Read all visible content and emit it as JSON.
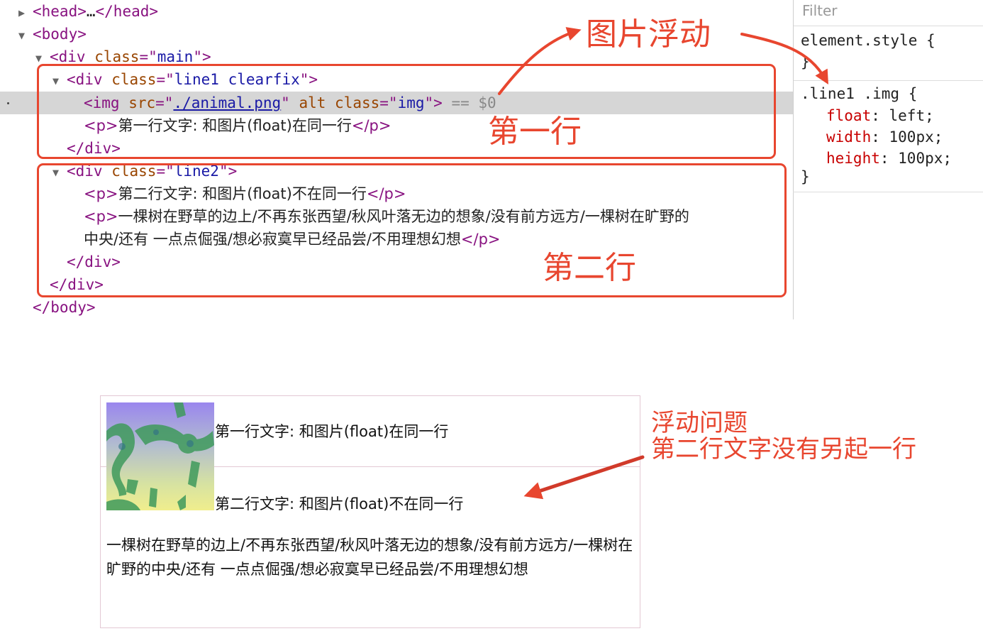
{
  "dom_tree": {
    "head_line": {
      "open": "<head>",
      "ellipsis": "…",
      "close": "</head>"
    },
    "body_open": "<body>",
    "main_div": {
      "open": "<div ",
      "attr": "class",
      "eq": "=\"",
      "val": "main",
      "end": "\">"
    },
    "line1_div": {
      "open": "<div ",
      "attr": "class",
      "eq": "=\"",
      "val": "line1 clearfix",
      "end": "\">"
    },
    "img_el": {
      "open": "<img ",
      "src_attr": "src",
      "src_eq": "=\"",
      "src_val": "./animal.png",
      "src_end": "\" ",
      "alt_attr": "alt",
      "class_attr": " class",
      "class_eq": "=\"",
      "class_val": "img",
      "end": "\">",
      "selected_marker": " == $0"
    },
    "p1": {
      "open": "<p>",
      "text": "第一行文字: 和图片(float)在同一行",
      "close": "</p>"
    },
    "div_close_1": "</div>",
    "line2_div": {
      "open": "<div ",
      "attr": "class",
      "eq": "=\"",
      "val": "line2",
      "end": "\">"
    },
    "p2": {
      "open": "<p>",
      "text": "第二行文字: 和图片(float)不在同一行",
      "close": "</p>"
    },
    "p3": {
      "open": "<p>",
      "text_line1": "一棵树在野草的边上/不再东张西望/秋风叶落无边的想象/没有前方远方/一棵树在旷野的",
      "text_line2": "中央/还有 一点点倔强/想必寂寞早已经品尝/不用理想幻想",
      "close": "</p>"
    },
    "div_close_2": "</div>",
    "div_close_3": "</div>",
    "body_close": "</body>"
  },
  "annotations": {
    "img_float": "图片浮动",
    "row1": "第一行",
    "row2": "第二行",
    "issue_line1": "浮动问题",
    "issue_line2": "第二行文字没有另起一行"
  },
  "styles_panel": {
    "filter_placeholder": "Filter",
    "element_style": "element.style {",
    "element_style_close": "}",
    "rule_selector": ".line1 .img {",
    "props": [
      {
        "name": "float",
        "value": "left;"
      },
      {
        "name": "width",
        "value": "100px;"
      },
      {
        "name": "height",
        "value": "100px;"
      }
    ],
    "rule_close": "}"
  },
  "preview": {
    "line1_text": "第一行文字: 和图片(float)在同一行",
    "line2_text": "第二行文字: 和图片(float)不在同一行",
    "paragraph": "一棵树在野草的边上/不再东张西望/秋风叶落无边的想象/没有前方远方/一棵树在旷野的中央/还有 一点点倔强/想必寂寞早已经品尝/不用理想幻想"
  },
  "colors": {
    "annotation": "#e8462f",
    "tag": "#881280",
    "attr_name": "#994500",
    "attr_value": "#1a1aa6",
    "css_prop": "#c80000"
  }
}
